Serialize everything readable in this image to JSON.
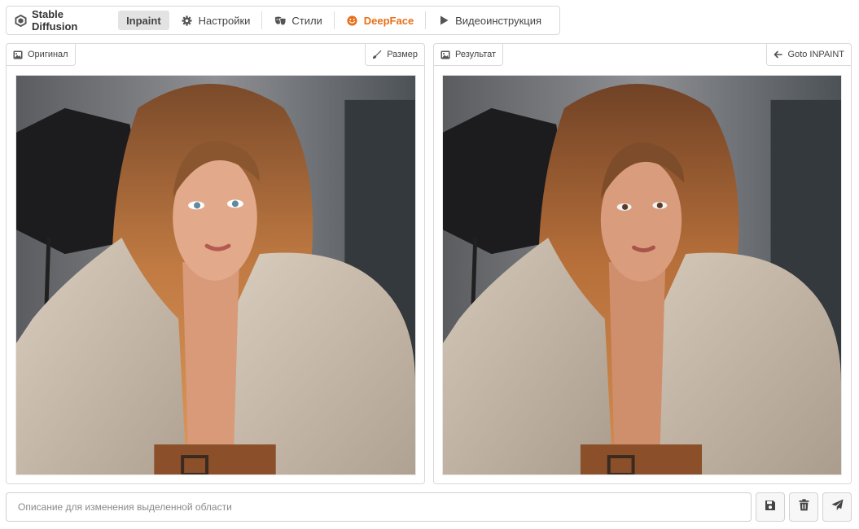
{
  "navbar": {
    "brand": "Stable Diffusion",
    "active_tab": "Inpaint",
    "settings": "Настройки",
    "styles": "Стили",
    "deepface": "DeepFace",
    "video": "Видеоинструкция",
    "deepface_color": "#e8701a"
  },
  "original_panel": {
    "tag": "Оригинал",
    "resize_button": "Размер"
  },
  "result_panel": {
    "tag": "Результат",
    "goto_button": "Goto INPAINT"
  },
  "prompt": {
    "placeholder": "Описание для изменения выделенной области"
  },
  "icons": {
    "brand": "hexagon-icon",
    "settings": "gear-icon",
    "styles": "mask-icon",
    "deepface": "smile-icon",
    "video": "play-icon",
    "original": "image-icon",
    "resize": "brush-icon",
    "result": "image-icon",
    "goto": "arrow-left-icon",
    "save": "floppy-disk-icon",
    "delete": "trash-icon",
    "send": "paper-plane-icon"
  }
}
